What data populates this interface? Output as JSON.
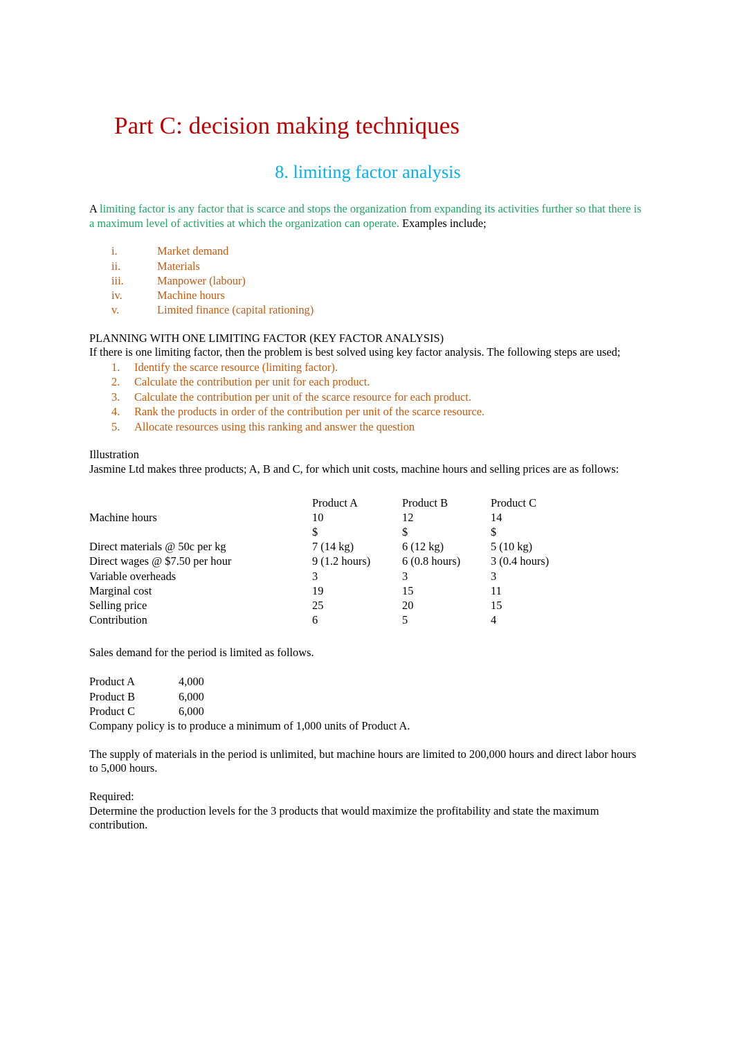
{
  "document": {
    "title": "Part C: decision making techniques",
    "subtitle": "8. limiting factor analysis",
    "colors": {
      "title": "#C00000",
      "subtitle": "#00B0F0",
      "definition": "#21A366",
      "list": "#C55A11",
      "body": "#000000"
    }
  },
  "intro": {
    "lead_plain": "A ",
    "definition": "limiting factor is any factor that is scarce and stops the organization from expanding its activities further so that there is a maximum level of activities at which the organization can operate.",
    "trailing_plain": " Examples include;"
  },
  "examples_list": [
    {
      "marker": "i.",
      "label": "Market demand"
    },
    {
      "marker": "ii.",
      "label": "Materials"
    },
    {
      "marker": "iii.",
      "label": "Manpower (labour)"
    },
    {
      "marker": "iv.",
      "label": "Machine hours"
    },
    {
      "marker": "v.",
      "label": "Limited finance (capital rationing)"
    }
  ],
  "planning": {
    "heading": "PLANNING WITH ONE LIMITING FACTOR (KEY FACTOR ANALYSIS)",
    "intro": "If there is one limiting factor, then the problem is best solved using key factor analysis. The following steps are used;",
    "steps": [
      {
        "marker": "1.",
        "label": "Identify the scarce resource (limiting factor)."
      },
      {
        "marker": "2.",
        "label": "Calculate the contribution per unit for each product."
      },
      {
        "marker": "3.",
        "label": "Calculate the contribution per unit of the scarce resource for each product."
      },
      {
        "marker": "4.",
        "label": "Rank the products in order of the contribution per unit of the scarce resource."
      },
      {
        "marker": "5.",
        "label": "Allocate resources using this ranking and answer the question"
      }
    ]
  },
  "illustration": {
    "heading": "Illustration",
    "intro": "Jasmine Ltd makes three products; A, B and C, for which unit costs, machine hours and selling prices are as follows:"
  },
  "cost_table": {
    "columns": [
      "",
      "Product A",
      "Product B",
      "Product C"
    ],
    "rows": [
      {
        "label": "Machine hours",
        "a": "10",
        "b": "12",
        "c": "14"
      },
      {
        "label": "",
        "a": "$",
        "b": "$",
        "c": "$"
      },
      {
        "label": "Direct materials @ 50c per kg",
        "a": "7 (14 kg)",
        "b": "6 (12 kg)",
        "c": "5 (10 kg)"
      },
      {
        "label": "Direct wages @ $7.50 per hour",
        "a": "9 (1.2 hours)",
        "b": "6 (0.8 hours)",
        "c": "3 (0.4 hours)"
      },
      {
        "label": "Variable overheads",
        "a": "3",
        "b": "3",
        "c": "3"
      },
      {
        "label": "Marginal cost",
        "a": "19",
        "b": "15",
        "c": "11"
      },
      {
        "label": "Selling price",
        "a": "25",
        "b": "20",
        "c": "15"
      },
      {
        "label": "Contribution",
        "a": "6",
        "b": "5",
        "c": "4"
      }
    ]
  },
  "demand": {
    "intro": "Sales demand for the period is limited as follows.",
    "rows": [
      {
        "label": "Product A",
        "value": "4,000"
      },
      {
        "label": "Product B",
        "value": "6,000"
      },
      {
        "label": "Product C",
        "value": "6,000"
      }
    ],
    "policy": "Company policy is to produce a minimum of 1,000 units of Product A."
  },
  "constraints": {
    "text": "The supply of materials in the period is unlimited, but machine hours are limited to 200,000 hours and direct labor hours to 5,000 hours."
  },
  "required": {
    "heading": "Required:",
    "text": "Determine the production levels for the 3 products that would maximize the profitability and state the maximum contribution."
  }
}
